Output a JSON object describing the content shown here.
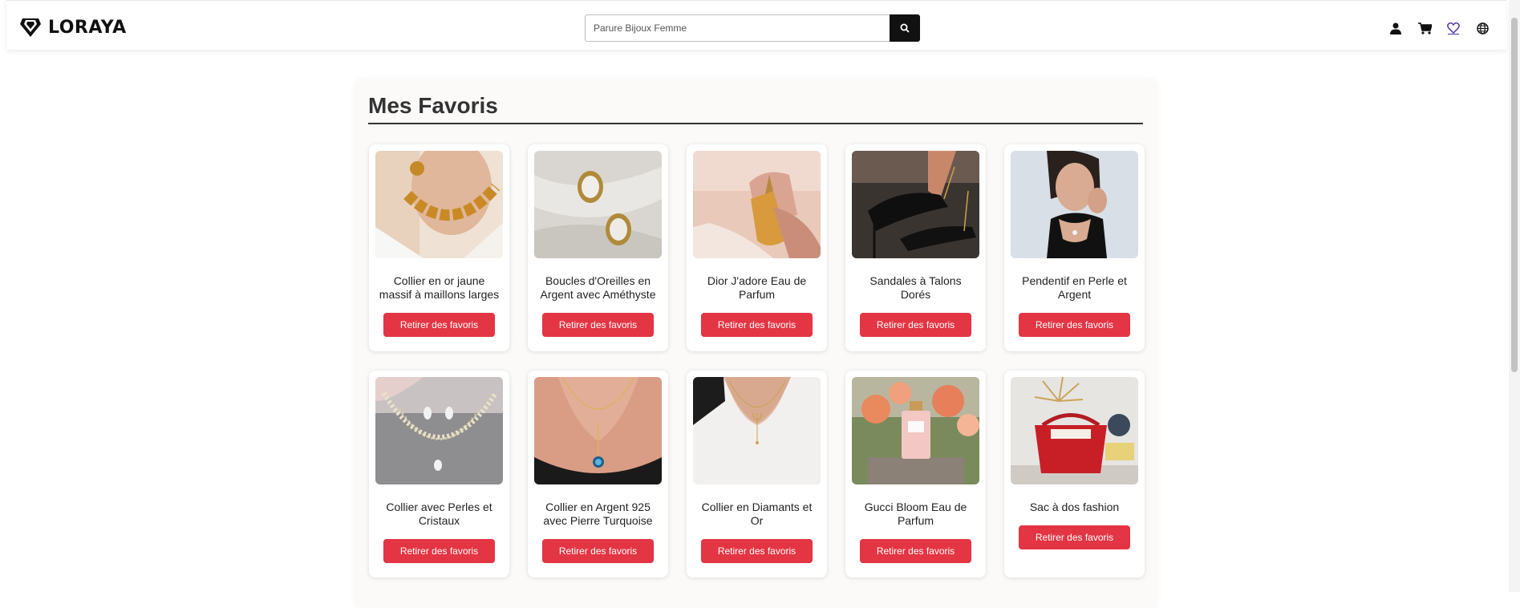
{
  "brand": {
    "name": "LORAYA",
    "logo_icon": "diamond-logo-icon"
  },
  "search": {
    "placeholder": "Parure Bijoux Femme",
    "value": "",
    "button_icon": "search-icon"
  },
  "nav_icons": [
    "user-icon",
    "cart-icon",
    "heart-icon",
    "globe-icon"
  ],
  "favorites": {
    "title": "Mes Favoris",
    "remove_label": "Retirer des favoris",
    "items": [
      {
        "name": "Collier en or jaune massif à maillons larges",
        "image": "gold-chain-necklace"
      },
      {
        "name": "Boucles d'Oreilles en Argent avec Améthyste",
        "image": "pearl-earrings"
      },
      {
        "name": "Dior J'adore Eau de Parfum",
        "image": "perfume-bottle"
      },
      {
        "name": "Sandales à Talons Dorés",
        "image": "black-heels"
      },
      {
        "name": "Pendentif en Perle et Argent",
        "image": "woman-pendant"
      },
      {
        "name": "Collier avec Perles et Cristaux",
        "image": "crystal-necklace-set"
      },
      {
        "name": "Collier en Argent 925 avec Pierre Turquoise",
        "image": "turquoise-pendant"
      },
      {
        "name": "Collier en Diamants et Or",
        "image": "moon-necklace"
      },
      {
        "name": "Gucci Bloom Eau de Parfum",
        "image": "pink-perfume-flowers"
      },
      {
        "name": "Sac à dos fashion",
        "image": "red-handbag"
      }
    ]
  },
  "colors": {
    "accent": "#e33543",
    "dark": "#111111"
  }
}
